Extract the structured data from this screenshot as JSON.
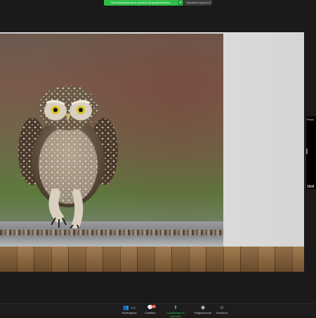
{
  "banner": {
    "share_text": "Stai visualizzando lo schermo di quarantinomus",
    "view_options": "Visualizza opzioni"
  },
  "participant_thumb": {
    "name": "Rinus"
  },
  "toolbar": {
    "participants": {
      "label": "Partecipanti",
      "count": "193"
    },
    "chat": {
      "label": "Chattare",
      "badge": "83"
    },
    "share": {
      "label": "Condividere lo schermo"
    },
    "record": {
      "label": "Registrazione"
    },
    "reactions": {
      "label": "Reazioni"
    }
  },
  "colors": {
    "share_green": "#2fbf4a",
    "badge_red": "#e0332f"
  }
}
